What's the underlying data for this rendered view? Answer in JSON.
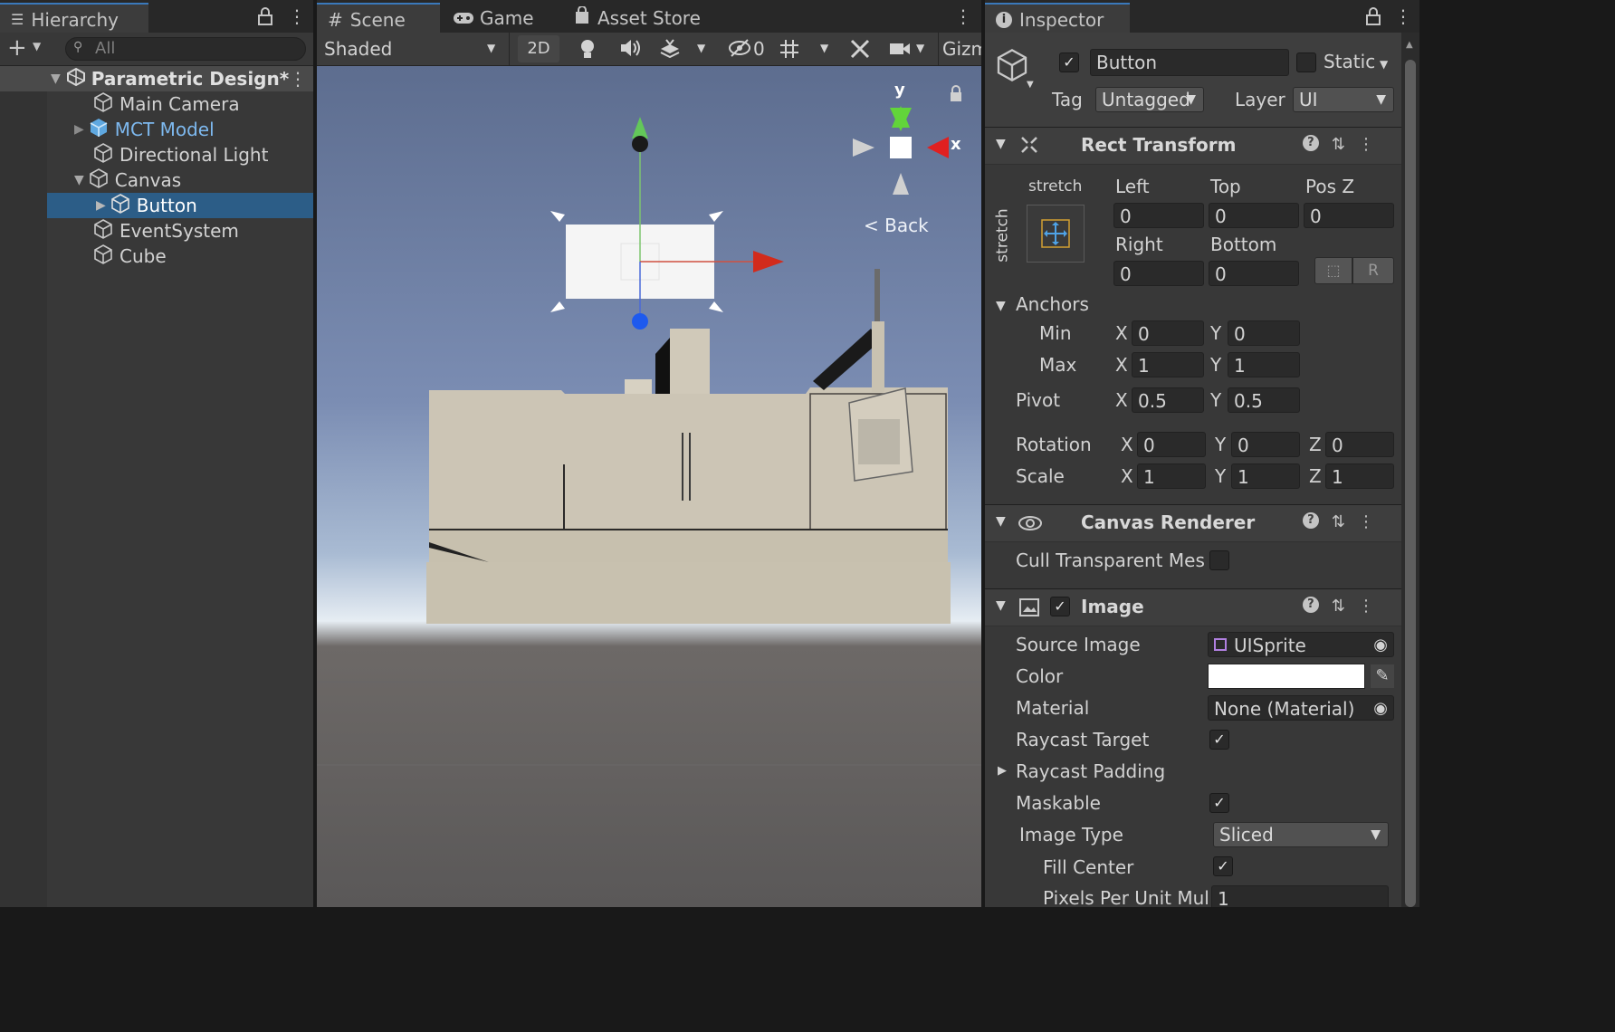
{
  "hierarchy": {
    "tab_label": "Hierarchy",
    "search_placeholder": "All",
    "scene_name": "Parametric Design*",
    "items": [
      {
        "label": "Main Camera"
      },
      {
        "label": "MCT Model"
      },
      {
        "label": "Directional Light"
      },
      {
        "label": "Canvas"
      },
      {
        "label": "Button"
      },
      {
        "label": "EventSystem"
      },
      {
        "label": "Cube"
      }
    ]
  },
  "scene": {
    "tabs": [
      "Scene",
      "Game",
      "Asset Store"
    ],
    "shading_mode": "Shaded",
    "mode_2d": "2D",
    "hidden_count": "0",
    "gizmos_label": "Gizm",
    "gizmo_y": "y",
    "gizmo_x": "x",
    "back_label": "< Back"
  },
  "inspector": {
    "tab_label": "Inspector",
    "object_name": "Button",
    "static_label": "Static",
    "tag_label": "Tag",
    "tag_value": "Untagged",
    "layer_label": "Layer",
    "layer_value": "UI",
    "rect_transform": {
      "title": "Rect Transform",
      "stretch_h": "stretch",
      "stretch_v": "stretch",
      "left_label": "Left",
      "left": "0",
      "top_label": "Top",
      "top": "0",
      "posz_label": "Pos Z",
      "posz": "0",
      "right_label": "Right",
      "right": "0",
      "bottom_label": "Bottom",
      "bottom": "0",
      "r_button": "R",
      "anchors_label": "Anchors",
      "min_label": "Min",
      "min_x": "0",
      "min_y": "0",
      "max_label": "Max",
      "max_x": "1",
      "max_y": "1",
      "pivot_label": "Pivot",
      "pivot_x": "0.5",
      "pivot_y": "0.5",
      "rotation_label": "Rotation",
      "rot_x": "0",
      "rot_y": "0",
      "rot_z": "0",
      "scale_label": "Scale",
      "scale_x": "1",
      "scale_y": "1",
      "scale_z": "1",
      "x": "X",
      "y": "Y",
      "z": "Z"
    },
    "canvas_renderer": {
      "title": "Canvas Renderer",
      "cull_label": "Cull Transparent Mes"
    },
    "image": {
      "title": "Image",
      "source_label": "Source Image",
      "source_value": "UISprite",
      "color_label": "Color",
      "color_value": "#ffffff",
      "material_label": "Material",
      "material_value": "None (Material)",
      "raycast_target_label": "Raycast Target",
      "raycast_padding_label": "Raycast Padding",
      "maskable_label": "Maskable",
      "image_type_label": "Image Type",
      "image_type_value": "Sliced",
      "fill_center_label": "Fill Center",
      "ppu_label": "Pixels Per Unit Mul",
      "ppu_value": "1"
    }
  }
}
